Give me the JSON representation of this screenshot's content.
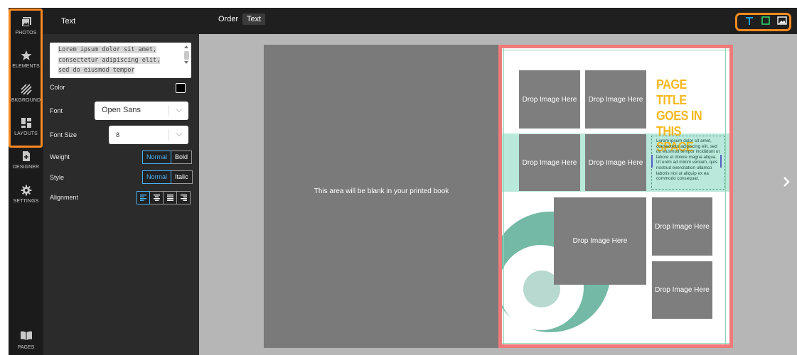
{
  "rail": {
    "items": [
      {
        "label": "PHOTOS",
        "icon": "photos-icon"
      },
      {
        "label": "ELEMENTS",
        "icon": "star-icon"
      },
      {
        "label": "BKGROUND",
        "icon": "stripes-icon"
      },
      {
        "label": "LAYOUTS",
        "icon": "layout-icon"
      },
      {
        "label": "DESIGNER",
        "icon": "add-page-icon"
      },
      {
        "label": "SETTINGS",
        "icon": "gear-icon"
      }
    ],
    "pages_label": "PAGES"
  },
  "panel": {
    "title": "Text",
    "text_lines": [
      "Lorem ipsum dolor sit amet,",
      "consectetur adipiscing elit,",
      "sed do eiusmod tempor"
    ],
    "color_label": "Color",
    "color_value": "#000000",
    "font_label": "Font",
    "font_value": "Open Sans",
    "size_label": "Font Size",
    "size_value": "8",
    "weight_label": "Weight",
    "weight_options": [
      "Normal",
      "Bold"
    ],
    "style_label": "Style",
    "style_options": [
      "Normal",
      "Italic"
    ],
    "alignment_label": "Alignment",
    "alignment_options": [
      "align-left-icon",
      "align-center-icon",
      "align-justify-icon",
      "align-right-icon"
    ]
  },
  "topbar": {
    "tabs": [
      "Order",
      "Text"
    ],
    "active_tab": "Text",
    "tools": [
      "text-tool-icon",
      "shape-tool-icon",
      "image-tool-icon"
    ]
  },
  "canvas": {
    "left_page_text": "This area will be blank in your printed book",
    "drop_label": "Drop Image Here",
    "page_title": "PAGE TITLE GOES IN THIS SPACE",
    "body_text": "Lorem ipsum dolor sit amet, consectetur adipiscing elit, sed do eiusmod tempor incididunt ut labore et dolore magna aliqua. Ut enim ad minim veniam, quis nostrud exercitation ullamco laboris nisi ut aliquip ex ea commodo consequat."
  },
  "colors": {
    "accent_highlight": "#f7891f",
    "active_option": "#4ab2f7",
    "page_border": "#f07a7a",
    "title_yellow": "#f5b81e",
    "band_mint": "#b9e9da",
    "circle_teal": "#74b9a6"
  }
}
